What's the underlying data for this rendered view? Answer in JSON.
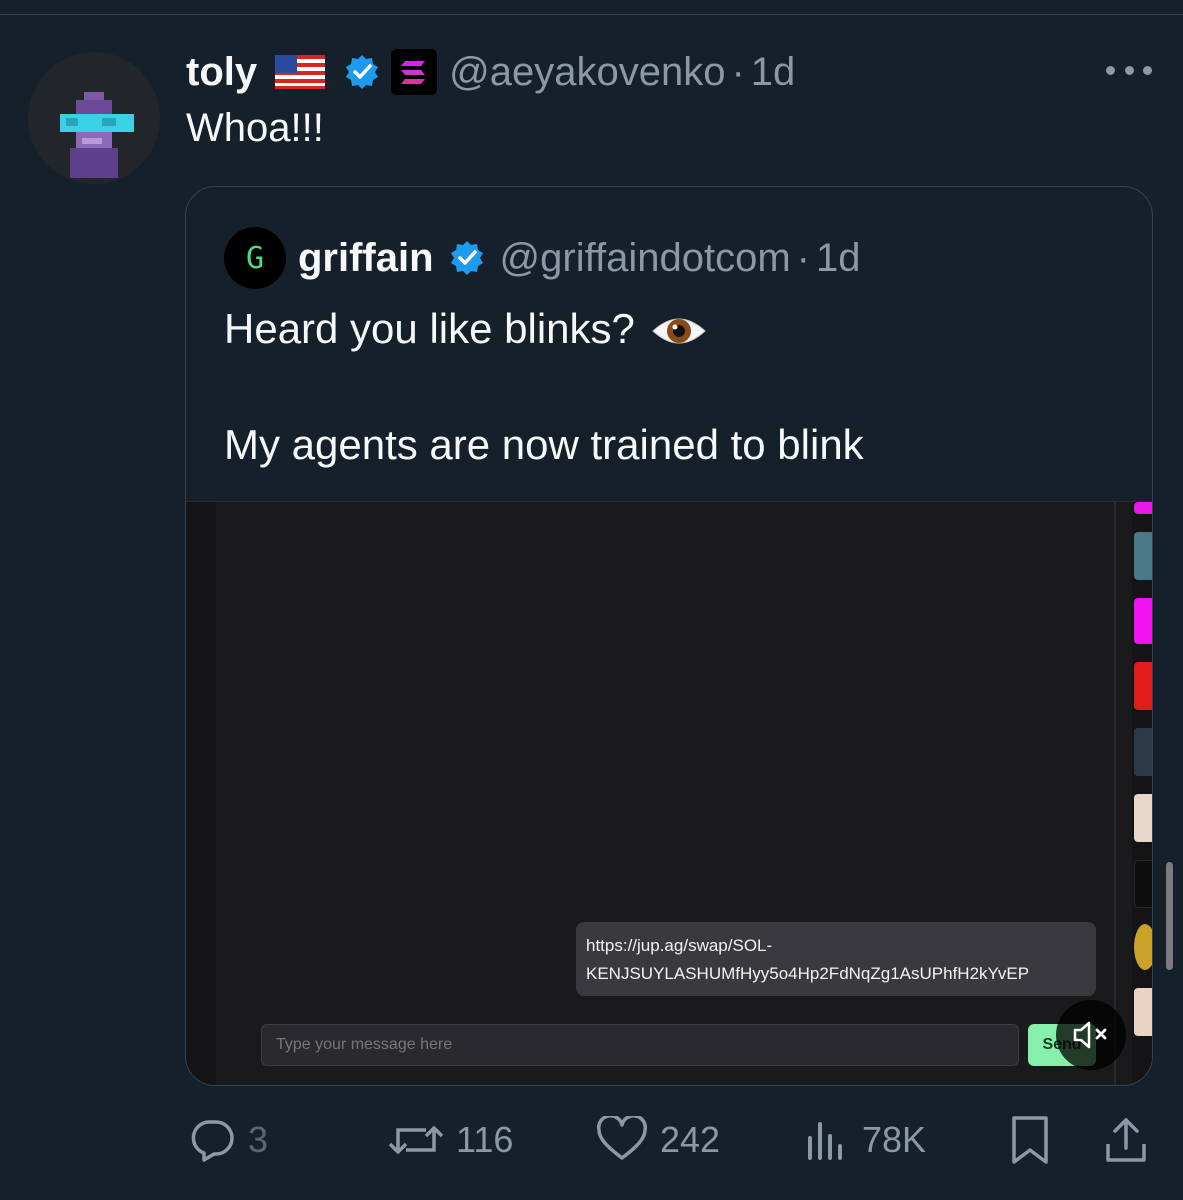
{
  "tweet": {
    "author_name": "toly",
    "author_handle": "@aeyakovenko",
    "separator": "·",
    "time": "1d",
    "text": "Whoa!!!"
  },
  "quoted_tweet": {
    "author_avatar_letter": "G",
    "author_name": "griffain",
    "author_handle": "@griffaindotcom",
    "separator": "·",
    "time": "1d",
    "text_line1": "Heard you like blinks?",
    "text_line2": "My agents are now trained to blink",
    "video": {
      "message_link_line1": "https://jup.ag/swap/SOL-",
      "message_link_line2": "KENJSUYLASHUMfHyy5o4Hp2FdNqZg1AsUPhfH2kYvEP",
      "input_placeholder": "Type your message here",
      "send_label": "Send"
    }
  },
  "actions": {
    "replies": "3",
    "reposts": "116",
    "likes": "242",
    "views": "78K"
  },
  "colors": {
    "background": "#15202b",
    "secondary_text": "#8b98a5",
    "verified": "#1d9bf0",
    "send_button": "#86efac"
  },
  "icons": [
    "flag-us-icon",
    "verified-badge-icon",
    "solana-icon",
    "more-icon",
    "eye-emoji-icon",
    "mute-icon",
    "reply-icon",
    "repost-icon",
    "like-icon",
    "views-icon",
    "bookmark-icon",
    "share-icon"
  ]
}
